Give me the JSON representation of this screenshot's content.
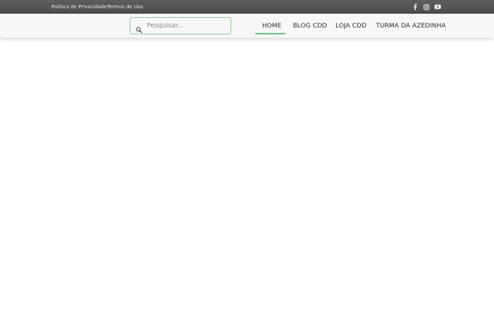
{
  "topbar": {
    "links": [
      {
        "label": "Política de Privacidade"
      },
      {
        "label": "Termos de Uso"
      }
    ],
    "social": [
      {
        "icon": "facebook-icon"
      },
      {
        "icon": "instagram-icon"
      },
      {
        "icon": "youtube-icon"
      }
    ]
  },
  "header": {
    "search": {
      "placeholder": "Pesquisar...",
      "value": ""
    },
    "nav": [
      {
        "label": "HOME",
        "active": true
      },
      {
        "label": "BLOG CDD",
        "active": false
      },
      {
        "label": "LOJA CDD",
        "active": false
      },
      {
        "label": "TURMA DA AZEDINHA",
        "active": false
      }
    ]
  },
  "colors": {
    "topbar_bg": "#555555",
    "header_bg": "#f7f7f7",
    "accent": "#6cbf7c",
    "nav_text": "#2b2b2b"
  }
}
